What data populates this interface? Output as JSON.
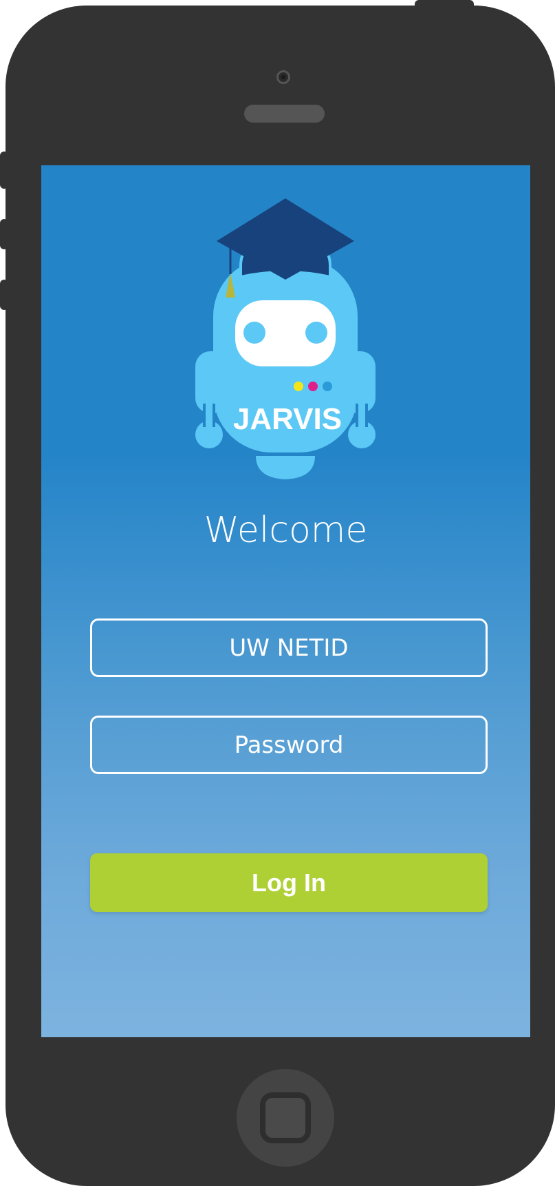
{
  "app": {
    "logo_text": "JARVIS",
    "welcome": "Welcome"
  },
  "login_form": {
    "netid_placeholder": "UW NETID",
    "password_placeholder": "Password",
    "login_label": "Log In"
  },
  "colors": {
    "screen_top": "#2484c8",
    "screen_bottom": "#7db3df",
    "login_button": "#aed035",
    "robot_body": "#5bc8f5",
    "cap": "#17427b",
    "phone": "#333333"
  },
  "icons": {
    "logo": "graduate-robot-icon",
    "home": "home-button-icon"
  }
}
